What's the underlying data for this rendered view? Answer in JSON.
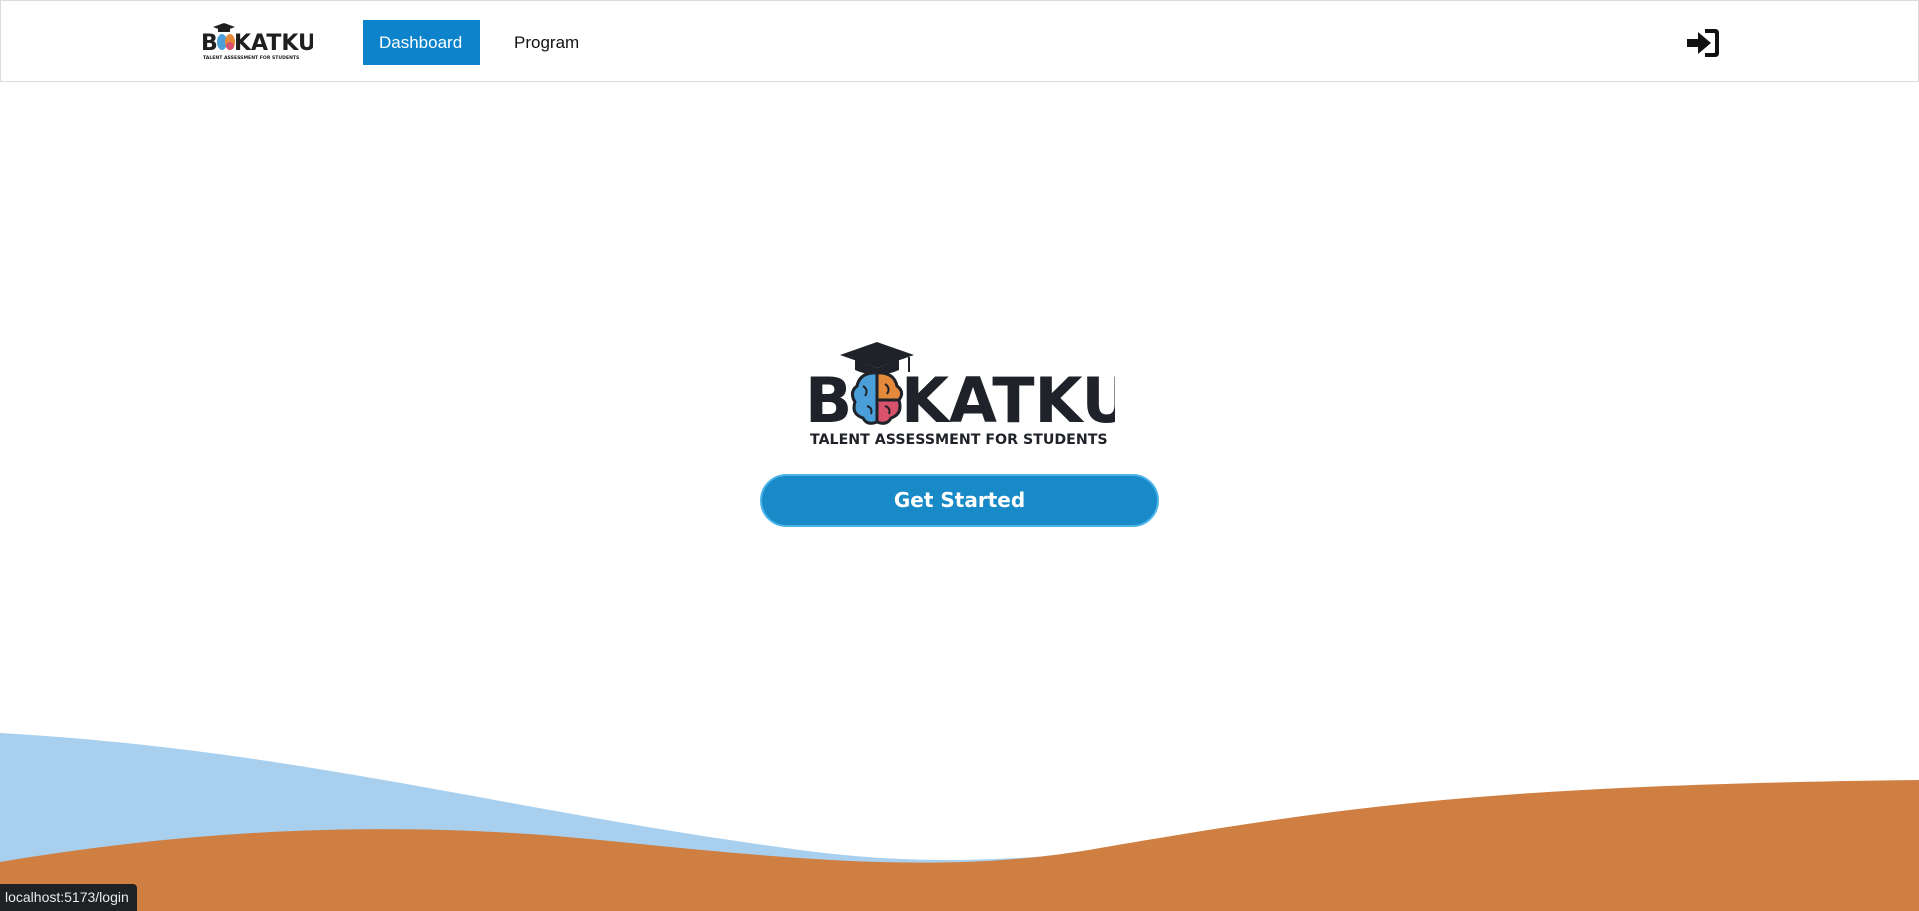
{
  "nav": {
    "logo_alt": "BAKATKU - Talent Assessment for Students",
    "items": [
      {
        "label": "Dashboard",
        "active": true
      },
      {
        "label": "Program",
        "active": false
      }
    ],
    "login_icon": "sign-in-icon"
  },
  "brand": {
    "name_left": "B",
    "name_right": "KATKU",
    "tagline": "TALENT ASSESSMENT FOR STUDENTS"
  },
  "hero": {
    "cta_label": "Get Started"
  },
  "status_bar": {
    "url": "localhost:5173/login"
  },
  "colors": {
    "primary_blue": "#178ac7",
    "nav_active": "#0d83cc",
    "wave_light_blue": "#a8d0ee",
    "wave_orange": "#d07f42",
    "brain_blue": "#4a9fd8",
    "brain_orange": "#e58a3a",
    "brain_pink": "#d9526b",
    "brain_green": "#6aa84f"
  }
}
